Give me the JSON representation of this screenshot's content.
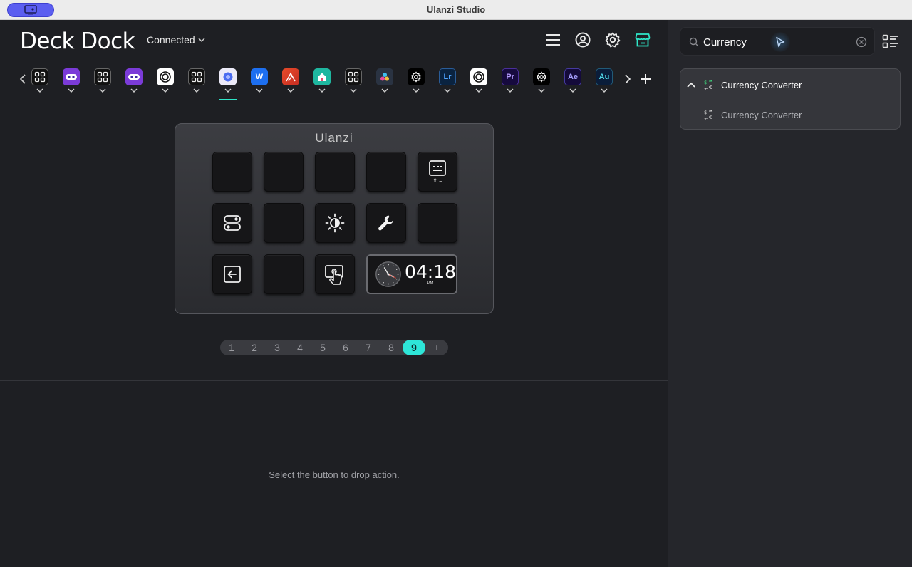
{
  "window": {
    "title": "Ulanzi Studio"
  },
  "header": {
    "app_title": "Deck Dock",
    "connection": "Connected"
  },
  "profiles": [
    {
      "icon": "grid-icon"
    },
    {
      "icon": "robot-icon"
    },
    {
      "icon": "grid-icon"
    },
    {
      "icon": "robot-icon"
    },
    {
      "icon": "ring-icon"
    },
    {
      "icon": "grid-icon"
    },
    {
      "icon": "app-blue-icon"
    },
    {
      "label": "W"
    },
    {
      "icon": "affinity-icon"
    },
    {
      "icon": "home-icon"
    },
    {
      "icon": "grid-icon"
    },
    {
      "icon": "davinci-icon"
    },
    {
      "icon": "gear-icon"
    },
    {
      "label": "Lr"
    },
    {
      "icon": "ring-icon"
    },
    {
      "label": "Pr"
    },
    {
      "icon": "gear-icon"
    },
    {
      "label": "Ae"
    },
    {
      "label": "Au"
    }
  ],
  "deck": {
    "brand": "Ulanzi",
    "keys": {
      "k5": "keyboard-icon",
      "k6": "toggle-icon",
      "k8": "brightness-icon",
      "k9": "wrench-icon",
      "k11": "back-icon",
      "k13": "touch-screen-icon"
    },
    "key5_sub": "⇧ =",
    "clock": {
      "time": "04:18",
      "ampm": "PM"
    }
  },
  "pager": {
    "pages": [
      "1",
      "2",
      "3",
      "4",
      "5",
      "6",
      "7",
      "8",
      "9",
      "+"
    ],
    "active": "9"
  },
  "hint": "Select the button to drop action.",
  "sidebar": {
    "search_value": "Currency",
    "results": {
      "group": "Currency Converter",
      "item": "Currency Converter"
    }
  },
  "colors": {
    "accent": "#2ee6c8",
    "page_active": "#2ee6d8",
    "titlebar_pill": "#5b5ef0"
  }
}
